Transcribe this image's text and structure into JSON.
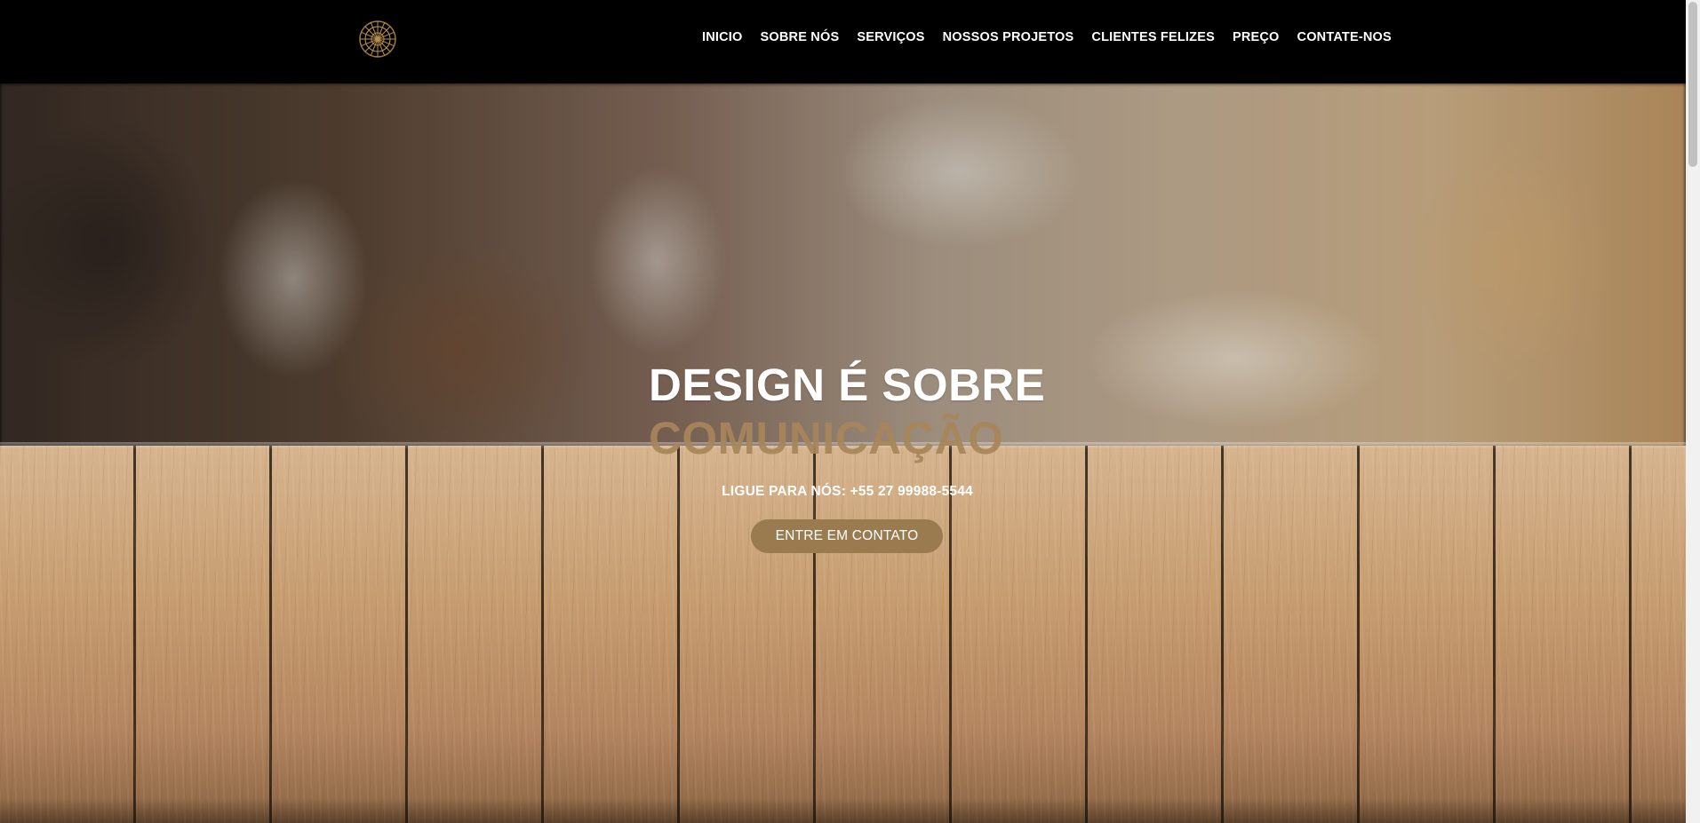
{
  "header": {
    "logo_icon": "gold-mandala-icon",
    "nav": [
      {
        "label": "INICIO"
      },
      {
        "label": "SOBRE NÓS"
      },
      {
        "label": "SERVIÇOS"
      },
      {
        "label": "NOSSOS PROJETOS"
      },
      {
        "label": "CLIENTES FELIZES"
      },
      {
        "label": "PREÇO"
      },
      {
        "label": "CONTATE-NOS"
      }
    ]
  },
  "hero": {
    "title_line1": "DESIGN É SOBRE",
    "title_line2": "COMUNICAÇÃO",
    "call_text": "LIGUE PARA NÓS: +55 27 99988-5544",
    "cta_label": "ENTRE EM CONTATO"
  },
  "colors": {
    "header_bg": "#000000",
    "accent_gold": "#9a7a4f",
    "title_accent": "#a8865a"
  }
}
